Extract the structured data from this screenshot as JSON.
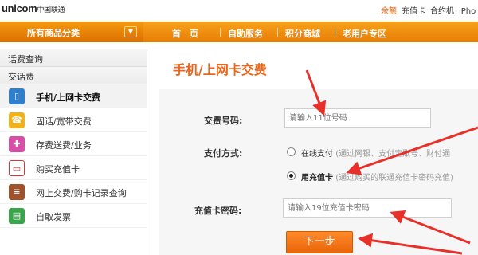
{
  "brand": {
    "logo_text": "unicom",
    "logo_cn": "中国联通"
  },
  "toplinks": [
    "余额",
    "充值卡",
    "合约机",
    "iPho"
  ],
  "nav": {
    "category_label": "所有商品分类",
    "items": [
      "首　页",
      "自助服务",
      "积分商城",
      "老用户专区"
    ]
  },
  "sidebar": {
    "sections": [
      "话费查询",
      "交话费"
    ],
    "items": [
      {
        "label": "手机/上网卡交费",
        "icon": "phone-card-icon",
        "active": true
      },
      {
        "label": "固话/宽带交费",
        "icon": "landline-phone-icon"
      },
      {
        "label": "存费送费/业务",
        "icon": "gift-icon"
      },
      {
        "label": "购买充值卡",
        "icon": "recharge-card-icon"
      },
      {
        "label": "网上交费/购卡记录查询",
        "icon": "record-list-icon"
      },
      {
        "label": "自取发票",
        "icon": "invoice-icon"
      }
    ]
  },
  "main": {
    "title": "手机/上网卡交费",
    "phone_label": "交费号码:",
    "phone_placeholder": "请输入11位号码",
    "pay_label": "支付方式:",
    "pay_options": [
      {
        "label": "在线支付",
        "note": "(通过网银、支付宝账号、财付通",
        "selected": false
      },
      {
        "label": "用充值卡",
        "note": "(通过购买的联通充值卡密码充值)",
        "selected": true
      }
    ],
    "card_label": "充值卡密码:",
    "card_placeholder": "请输入19位充值卡密码",
    "submit_label": "下一步"
  },
  "colors": {
    "accent": "#e8651b",
    "nav": "#f08c12",
    "arrow": "#e8302a"
  }
}
